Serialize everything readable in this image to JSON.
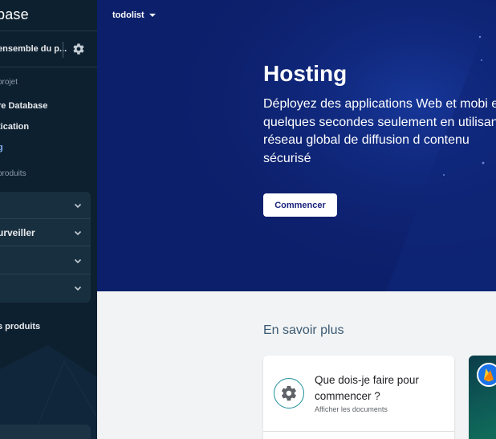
{
  "sidebar": {
    "brand": "base",
    "overview_label": "ensemble du p...",
    "section_project": "projet",
    "links": [
      {
        "label": "re Database"
      },
      {
        "label": "tication"
      },
      {
        "label": "g"
      }
    ],
    "section_products": "produits",
    "groups": [
      {
        "label": ""
      },
      {
        "label": "urveiller"
      },
      {
        "label": ""
      },
      {
        "label": ""
      }
    ],
    "all_products": "s produits"
  },
  "topbar": {
    "project_name": "todolist"
  },
  "hero": {
    "title": "Hosting",
    "description": "Déployez des applications Web et mobi en quelques secondes seulement en utilisant un réseau global de diffusion d contenu sécurisé",
    "cta": "Commencer"
  },
  "learn_more": {
    "title": "En savoir plus",
    "cards": [
      {
        "title": "Que dois-je faire pour commencer ?",
        "link": "Afficher les documents",
        "icon": "gear-icon"
      },
      {
        "icon": "firebase-icon"
      }
    ]
  },
  "colors": {
    "sidebar_bg": "#0d2030",
    "hero_bg": "#0c1f6b",
    "accent": "#8ab4f8",
    "teal": "#1e8e9a"
  }
}
